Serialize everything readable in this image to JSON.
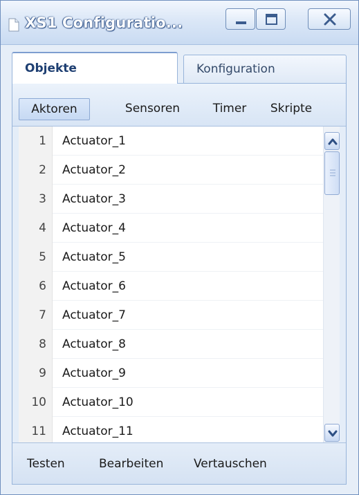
{
  "window": {
    "title": "XS1 Configuratio...",
    "min_icon": "minimize-icon",
    "max_icon": "maximize-icon",
    "close_icon": "close-icon"
  },
  "tabs": [
    {
      "label": "Objekte",
      "active": true
    },
    {
      "label": "Konfiguration",
      "active": false
    }
  ],
  "subtabs": [
    {
      "label": "Aktoren",
      "active": true
    },
    {
      "label": "Sensoren",
      "active": false
    },
    {
      "label": "Timer",
      "active": false
    },
    {
      "label": "Skripte",
      "active": false
    }
  ],
  "list": {
    "rows": [
      {
        "num": "1",
        "name": "Actuator_1"
      },
      {
        "num": "2",
        "name": "Actuator_2"
      },
      {
        "num": "3",
        "name": "Actuator_3"
      },
      {
        "num": "4",
        "name": "Actuator_4"
      },
      {
        "num": "5",
        "name": "Actuator_5"
      },
      {
        "num": "6",
        "name": "Actuator_6"
      },
      {
        "num": "7",
        "name": "Actuator_7"
      },
      {
        "num": "8",
        "name": "Actuator_8"
      },
      {
        "num": "9",
        "name": "Actuator_9"
      },
      {
        "num": "10",
        "name": "Actuator_10"
      },
      {
        "num": "11",
        "name": "Actuator_11"
      }
    ]
  },
  "actions": {
    "test_label": "Testen",
    "edit_label": "Bearbeiten",
    "swap_label": "Vertauschen"
  },
  "colors": {
    "accent": "#1e3f72",
    "frame": "#6f8fbe",
    "panel": "#e4edf8"
  }
}
